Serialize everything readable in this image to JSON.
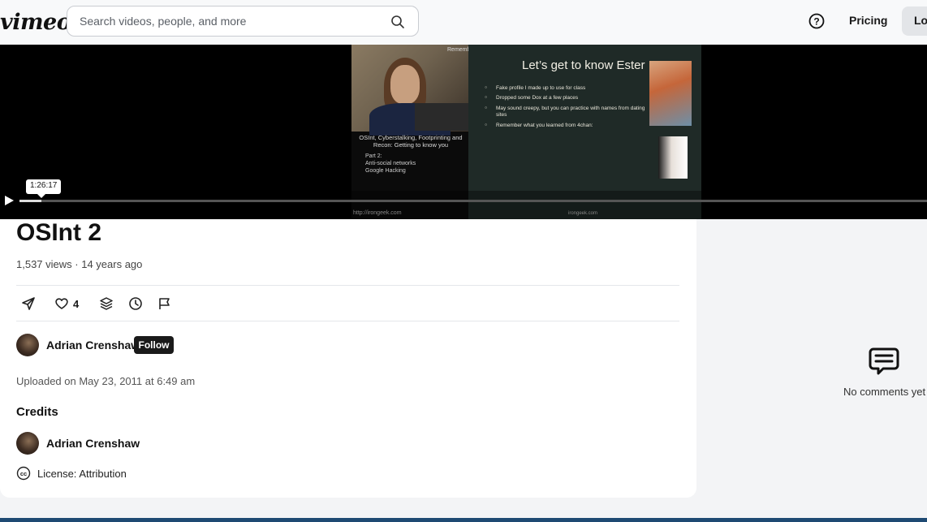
{
  "header": {
    "logo": "vimeo",
    "search_placeholder": "Search videos, people, and more",
    "help_icon": "help-icon",
    "pricing": "Pricing",
    "login": "Log"
  },
  "video": {
    "time_tooltip": "1:26:17",
    "progress_fraction": 0.024,
    "slide_left": {
      "remember": "Rememb",
      "caption": "OSInt, Cyberstalking, Footprinting and Recon: Getting to know you",
      "part": "Part 2:",
      "part_items": [
        "Anti-social networks",
        "Google Hacking"
      ],
      "url": "http://irongeek.com"
    },
    "slide_right": {
      "title": "Let’s get to know Ester",
      "bullets": [
        "Fake profile I made up to use for class",
        "Dropped some Dox at a few places",
        "May sound creepy, but you can practice with names from dating sites",
        "Remember what you learned from 4chan:"
      ],
      "url": "irongeek.com"
    }
  },
  "content": {
    "title": "OSInt 2",
    "views": "1,537 views",
    "age": "14 years ago",
    "like_count": "4",
    "uploader": "Adrian Crenshaw",
    "follow": "Follow",
    "uploaded": "Uploaded on May 23, 2011 at 6:49 am",
    "credits_heading": "Credits",
    "credit_name": "Adrian Crenshaw",
    "license": "License: Attribution"
  },
  "comments": {
    "empty_text": "No comments yet"
  }
}
